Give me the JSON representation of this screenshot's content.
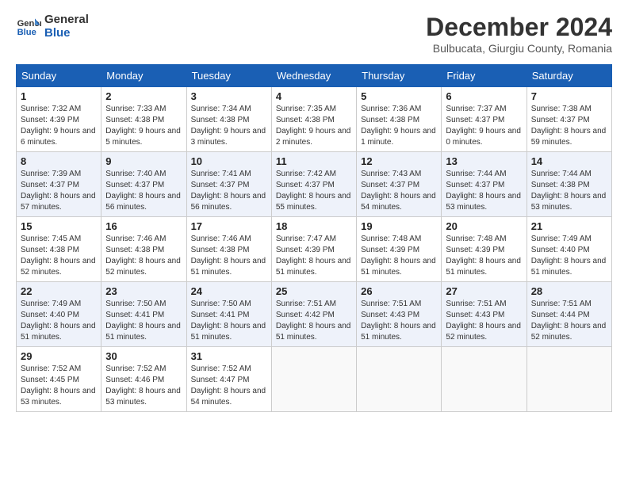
{
  "header": {
    "logo_line1": "General",
    "logo_line2": "Blue",
    "title": "December 2024",
    "subtitle": "Bulbucata, Giurgiu County, Romania"
  },
  "calendar": {
    "days_of_week": [
      "Sunday",
      "Monday",
      "Tuesday",
      "Wednesday",
      "Thursday",
      "Friday",
      "Saturday"
    ],
    "weeks": [
      [
        {
          "day": "1",
          "sunrise": "Sunrise: 7:32 AM",
          "sunset": "Sunset: 4:39 PM",
          "daylight": "Daylight: 9 hours and 6 minutes."
        },
        {
          "day": "2",
          "sunrise": "Sunrise: 7:33 AM",
          "sunset": "Sunset: 4:38 PM",
          "daylight": "Daylight: 9 hours and 5 minutes."
        },
        {
          "day": "3",
          "sunrise": "Sunrise: 7:34 AM",
          "sunset": "Sunset: 4:38 PM",
          "daylight": "Daylight: 9 hours and 3 minutes."
        },
        {
          "day": "4",
          "sunrise": "Sunrise: 7:35 AM",
          "sunset": "Sunset: 4:38 PM",
          "daylight": "Daylight: 9 hours and 2 minutes."
        },
        {
          "day": "5",
          "sunrise": "Sunrise: 7:36 AM",
          "sunset": "Sunset: 4:38 PM",
          "daylight": "Daylight: 9 hours and 1 minute."
        },
        {
          "day": "6",
          "sunrise": "Sunrise: 7:37 AM",
          "sunset": "Sunset: 4:37 PM",
          "daylight": "Daylight: 9 hours and 0 minutes."
        },
        {
          "day": "7",
          "sunrise": "Sunrise: 7:38 AM",
          "sunset": "Sunset: 4:37 PM",
          "daylight": "Daylight: 8 hours and 59 minutes."
        }
      ],
      [
        {
          "day": "8",
          "sunrise": "Sunrise: 7:39 AM",
          "sunset": "Sunset: 4:37 PM",
          "daylight": "Daylight: 8 hours and 57 minutes."
        },
        {
          "day": "9",
          "sunrise": "Sunrise: 7:40 AM",
          "sunset": "Sunset: 4:37 PM",
          "daylight": "Daylight: 8 hours and 56 minutes."
        },
        {
          "day": "10",
          "sunrise": "Sunrise: 7:41 AM",
          "sunset": "Sunset: 4:37 PM",
          "daylight": "Daylight: 8 hours and 56 minutes."
        },
        {
          "day": "11",
          "sunrise": "Sunrise: 7:42 AM",
          "sunset": "Sunset: 4:37 PM",
          "daylight": "Daylight: 8 hours and 55 minutes."
        },
        {
          "day": "12",
          "sunrise": "Sunrise: 7:43 AM",
          "sunset": "Sunset: 4:37 PM",
          "daylight": "Daylight: 8 hours and 54 minutes."
        },
        {
          "day": "13",
          "sunrise": "Sunrise: 7:44 AM",
          "sunset": "Sunset: 4:37 PM",
          "daylight": "Daylight: 8 hours and 53 minutes."
        },
        {
          "day": "14",
          "sunrise": "Sunrise: 7:44 AM",
          "sunset": "Sunset: 4:38 PM",
          "daylight": "Daylight: 8 hours and 53 minutes."
        }
      ],
      [
        {
          "day": "15",
          "sunrise": "Sunrise: 7:45 AM",
          "sunset": "Sunset: 4:38 PM",
          "daylight": "Daylight: 8 hours and 52 minutes."
        },
        {
          "day": "16",
          "sunrise": "Sunrise: 7:46 AM",
          "sunset": "Sunset: 4:38 PM",
          "daylight": "Daylight: 8 hours and 52 minutes."
        },
        {
          "day": "17",
          "sunrise": "Sunrise: 7:46 AM",
          "sunset": "Sunset: 4:38 PM",
          "daylight": "Daylight: 8 hours and 51 minutes."
        },
        {
          "day": "18",
          "sunrise": "Sunrise: 7:47 AM",
          "sunset": "Sunset: 4:39 PM",
          "daylight": "Daylight: 8 hours and 51 minutes."
        },
        {
          "day": "19",
          "sunrise": "Sunrise: 7:48 AM",
          "sunset": "Sunset: 4:39 PM",
          "daylight": "Daylight: 8 hours and 51 minutes."
        },
        {
          "day": "20",
          "sunrise": "Sunrise: 7:48 AM",
          "sunset": "Sunset: 4:39 PM",
          "daylight": "Daylight: 8 hours and 51 minutes."
        },
        {
          "day": "21",
          "sunrise": "Sunrise: 7:49 AM",
          "sunset": "Sunset: 4:40 PM",
          "daylight": "Daylight: 8 hours and 51 minutes."
        }
      ],
      [
        {
          "day": "22",
          "sunrise": "Sunrise: 7:49 AM",
          "sunset": "Sunset: 4:40 PM",
          "daylight": "Daylight: 8 hours and 51 minutes."
        },
        {
          "day": "23",
          "sunrise": "Sunrise: 7:50 AM",
          "sunset": "Sunset: 4:41 PM",
          "daylight": "Daylight: 8 hours and 51 minutes."
        },
        {
          "day": "24",
          "sunrise": "Sunrise: 7:50 AM",
          "sunset": "Sunset: 4:41 PM",
          "daylight": "Daylight: 8 hours and 51 minutes."
        },
        {
          "day": "25",
          "sunrise": "Sunrise: 7:51 AM",
          "sunset": "Sunset: 4:42 PM",
          "daylight": "Daylight: 8 hours and 51 minutes."
        },
        {
          "day": "26",
          "sunrise": "Sunrise: 7:51 AM",
          "sunset": "Sunset: 4:43 PM",
          "daylight": "Daylight: 8 hours and 51 minutes."
        },
        {
          "day": "27",
          "sunrise": "Sunrise: 7:51 AM",
          "sunset": "Sunset: 4:43 PM",
          "daylight": "Daylight: 8 hours and 52 minutes."
        },
        {
          "day": "28",
          "sunrise": "Sunrise: 7:51 AM",
          "sunset": "Sunset: 4:44 PM",
          "daylight": "Daylight: 8 hours and 52 minutes."
        }
      ],
      [
        {
          "day": "29",
          "sunrise": "Sunrise: 7:52 AM",
          "sunset": "Sunset: 4:45 PM",
          "daylight": "Daylight: 8 hours and 53 minutes."
        },
        {
          "day": "30",
          "sunrise": "Sunrise: 7:52 AM",
          "sunset": "Sunset: 4:46 PM",
          "daylight": "Daylight: 8 hours and 53 minutes."
        },
        {
          "day": "31",
          "sunrise": "Sunrise: 7:52 AM",
          "sunset": "Sunset: 4:47 PM",
          "daylight": "Daylight: 8 hours and 54 minutes."
        },
        null,
        null,
        null,
        null
      ]
    ]
  }
}
